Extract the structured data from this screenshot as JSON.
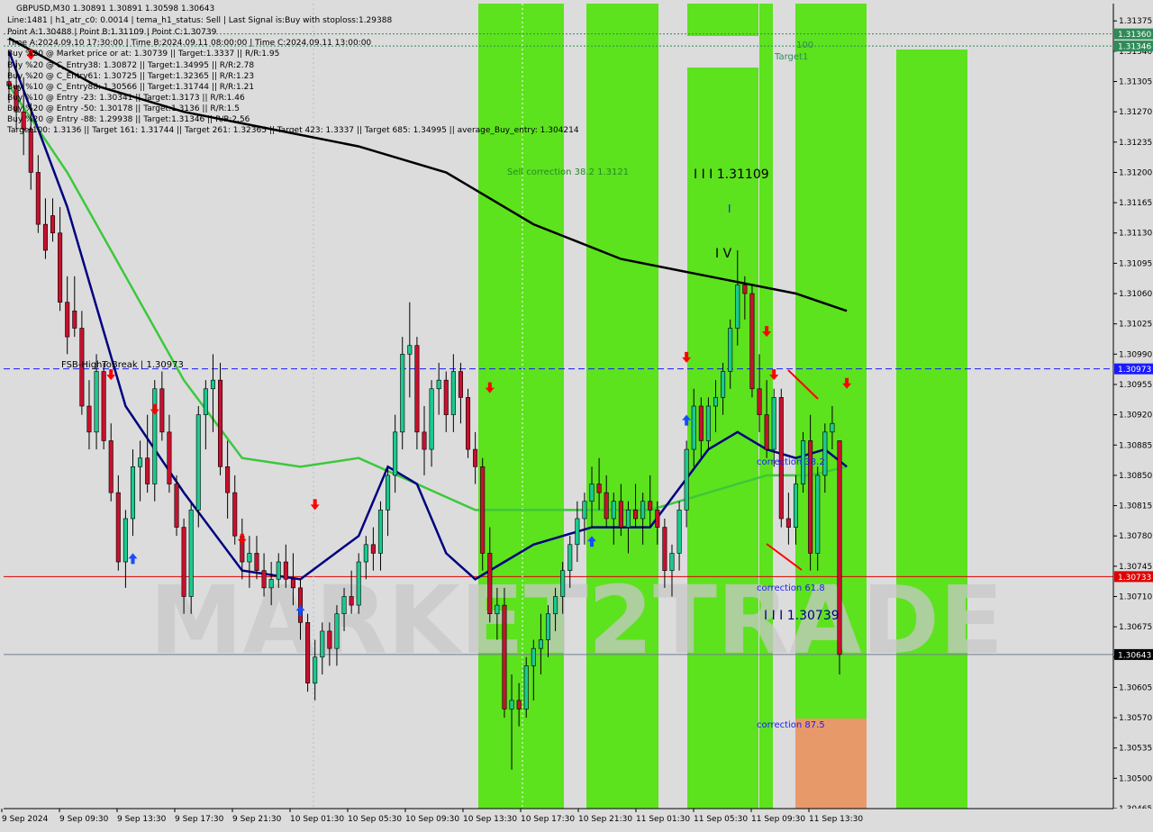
{
  "header": {
    "lines": [
      "GBPUSD,M30  1.30891 1.30891 1.30598 1.30643",
      "Line:1481  |  h1_atr_c0: 0.0014  |  tema_h1_status: Sell  |  Last Signal is:Buy with stoploss:1.29388",
      "Point A:1.30488  |  Point B:1.31109  |  Point C:1.30739",
      "Time A:2024.09.10 17:30:00  |  Time B:2024.09.11 08:00:00  |  Time C:2024.09.11 13:00:00",
      "Buy %20 @ Market price or at: 1.30739  ||  Target:1.3337  ||  R/R:1.95",
      "Buy %20 @ C_Entry38: 1.30872  ||  Target:1.34995  ||  R/R:2.78",
      "Buy %20 @ C_Entry61: 1.30725  ||  Target:1.32365  ||  R/R:1.23",
      "Buy %10 @ C_Entry88: 1.30566  ||  Target:1.31744  ||  R/R:1.21",
      "Buy %10 @ Entry -23: 1.30341  ||  Target:1.3173  ||  R/R:1.46",
      "Buy %20 @ Entry -50: 1.30178  ||  Target:1.3136  ||  R/R:1.5",
      "Buy %20 @ Entry -88: 1.29938  ||  Target:1.31346  ||  R/R:2.56",
      "Target100: 1.3136  ||  Target 161: 1.31744  ||  Target 261: 1.32365  ||  Target 423: 1.3337  ||  Target 685: 1.34995  ||  average_Buy_entry: 1.304214"
    ]
  },
  "annotations": {
    "fsb": "FSB-HighToBreak  |  1.30973",
    "sell_correction": "Sell correction 38.2  1.3121",
    "wave_b": "I I I 1.31109",
    "wave_i": "I",
    "wave_iv": "I V",
    "wave_c": "I I I 1.30739",
    "corr382": "correction 38.2",
    "corr618": "correction 61.8",
    "corr875": "correction 87.5",
    "target1": "Target1",
    "t100": "100"
  },
  "watermark": "MARKET2TRADE",
  "colors": {
    "background": "#dcdcdc",
    "bull_candle": "#1bc98e",
    "bear_candle": "#c8102e",
    "green_zone": "#5de21e",
    "orange_zone": "#e8996a",
    "ema_black": "#000000",
    "ema_navy": "#000080",
    "ema_green": "#3cc83c",
    "envelope": "#ff5a00",
    "fsb_line": "#1a1aff",
    "c_line": "#e00000",
    "last_line": "#708090",
    "target_line": "#2e8b57",
    "arrow_up": "#1a4cff",
    "arrow_down": "#ff0000"
  },
  "chart_data": {
    "type": "candlestick",
    "symbol": "GBPUSD",
    "timeframe": "M30",
    "ylim": [
      1.30465,
      1.31395
    ],
    "y_ticks": [
      "1.31375",
      "1.31340",
      "1.31305",
      "1.31270",
      "1.31235",
      "1.31200",
      "1.31165",
      "1.31130",
      "1.31095",
      "1.31060",
      "1.31025",
      "1.30990",
      "1.30955",
      "1.30920",
      "1.30885",
      "1.30850",
      "1.30815",
      "1.30780",
      "1.30745",
      "1.30710",
      "1.30675",
      "1.30640",
      "1.30605",
      "1.30570",
      "1.30535",
      "1.30500",
      "1.30465"
    ],
    "x_ticks": [
      "9 Sep 2024",
      "9 Sep 09:30",
      "9 Sep 13:30",
      "9 Sep 17:30",
      "9 Sep 21:30",
      "10 Sep 01:30",
      "10 Sep 05:30",
      "10 Sep 09:30",
      "10 Sep 13:30",
      "10 Sep 17:30",
      "10 Sep 21:30",
      "11 Sep 01:30",
      "11 Sep 05:30",
      "11 Sep 09:30",
      "11 Sep 13:30"
    ],
    "price_labels": {
      "target_a": "1.31360",
      "target_b": "1.31346",
      "fsb": "1.30973",
      "c_point": "1.30733",
      "last": "1.30643"
    },
    "levels": {
      "target_a": 1.3136,
      "target_b": 1.31346,
      "fsb": 1.30973,
      "c_point": 1.30733,
      "last": 1.30643
    },
    "ohlc": [
      [
        1.31305,
        1.3134,
        1.3128,
        1.313
      ],
      [
        1.313,
        1.3133,
        1.3125,
        1.3127
      ],
      [
        1.3127,
        1.3131,
        1.3122,
        1.3125
      ],
      [
        1.3125,
        1.3128,
        1.3118,
        1.312
      ],
      [
        1.312,
        1.3122,
        1.3113,
        1.3114
      ],
      [
        1.3114,
        1.3117,
        1.311,
        1.3111
      ],
      [
        1.3115,
        1.3117,
        1.3112,
        1.3113
      ],
      [
        1.3113,
        1.3116,
        1.3104,
        1.3105
      ],
      [
        1.3105,
        1.3108,
        1.3099,
        1.3101
      ],
      [
        1.3104,
        1.3108,
        1.3101,
        1.3102
      ],
      [
        1.3102,
        1.3104,
        1.3092,
        1.3093
      ],
      [
        1.3093,
        1.3096,
        1.3088,
        1.309
      ],
      [
        1.309,
        1.3099,
        1.3088,
        1.3097
      ],
      [
        1.3097,
        1.3098,
        1.3088,
        1.3089
      ],
      [
        1.3089,
        1.3091,
        1.3082,
        1.3083
      ],
      [
        1.3083,
        1.3085,
        1.3074,
        1.3075
      ],
      [
        1.3075,
        1.3081,
        1.3072,
        1.308
      ],
      [
        1.308,
        1.3088,
        1.3078,
        1.3086
      ],
      [
        1.3086,
        1.3089,
        1.3082,
        1.3087
      ],
      [
        1.3087,
        1.3092,
        1.3083,
        1.3084
      ],
      [
        1.3084,
        1.3096,
        1.3082,
        1.3095
      ],
      [
        1.3095,
        1.3097,
        1.3089,
        1.309
      ],
      [
        1.309,
        1.3092,
        1.3083,
        1.3084
      ],
      [
        1.3084,
        1.3085,
        1.3078,
        1.3079
      ],
      [
        1.3079,
        1.308,
        1.3069,
        1.3071
      ],
      [
        1.3071,
        1.3082,
        1.3069,
        1.3081
      ],
      [
        1.3081,
        1.3093,
        1.3079,
        1.3092
      ],
      [
        1.3092,
        1.3096,
        1.3088,
        1.3095
      ],
      [
        1.3095,
        1.3099,
        1.309,
        1.3096
      ],
      [
        1.3096,
        1.3098,
        1.3085,
        1.3086
      ],
      [
        1.3086,
        1.3089,
        1.308,
        1.3083
      ],
      [
        1.3083,
        1.3085,
        1.3077,
        1.3078
      ],
      [
        1.3078,
        1.308,
        1.3073,
        1.3075
      ],
      [
        1.3075,
        1.3078,
        1.3072,
        1.3076
      ],
      [
        1.3076,
        1.3078,
        1.3073,
        1.3074
      ],
      [
        1.3074,
        1.3076,
        1.3071,
        1.3072
      ],
      [
        1.3072,
        1.3075,
        1.307,
        1.3073
      ],
      [
        1.3073,
        1.3076,
        1.3072,
        1.3075
      ],
      [
        1.3075,
        1.3077,
        1.3072,
        1.3073
      ],
      [
        1.3073,
        1.3076,
        1.307,
        1.3072
      ],
      [
        1.3072,
        1.3073,
        1.3066,
        1.3068
      ],
      [
        1.3068,
        1.3069,
        1.306,
        1.3061
      ],
      [
        1.3061,
        1.3066,
        1.3059,
        1.3064
      ],
      [
        1.3064,
        1.3068,
        1.3062,
        1.3067
      ],
      [
        1.3067,
        1.3068,
        1.3063,
        1.3065
      ],
      [
        1.3065,
        1.307,
        1.3063,
        1.3069
      ],
      [
        1.3069,
        1.3072,
        1.3067,
        1.3071
      ],
      [
        1.3071,
        1.3074,
        1.3069,
        1.307
      ],
      [
        1.307,
        1.3076,
        1.3069,
        1.3075
      ],
      [
        1.3075,
        1.3078,
        1.3073,
        1.3077
      ],
      [
        1.3077,
        1.3079,
        1.3074,
        1.3076
      ],
      [
        1.3076,
        1.3082,
        1.3074,
        1.3081
      ],
      [
        1.3081,
        1.3086,
        1.3078,
        1.3085
      ],
      [
        1.3085,
        1.3092,
        1.3083,
        1.309
      ],
      [
        1.309,
        1.3101,
        1.3088,
        1.3099
      ],
      [
        1.3099,
        1.3105,
        1.3094,
        1.31
      ],
      [
        1.31,
        1.3101,
        1.3088,
        1.309
      ],
      [
        1.309,
        1.3093,
        1.3085,
        1.3088
      ],
      [
        1.3088,
        1.3096,
        1.3086,
        1.3095
      ],
      [
        1.3095,
        1.3098,
        1.3092,
        1.3096
      ],
      [
        1.3096,
        1.3097,
        1.309,
        1.3092
      ],
      [
        1.3092,
        1.3099,
        1.309,
        1.3097
      ],
      [
        1.3097,
        1.3098,
        1.3091,
        1.3094
      ],
      [
        1.3094,
        1.3095,
        1.3087,
        1.3088
      ],
      [
        1.3088,
        1.309,
        1.3084,
        1.3086
      ],
      [
        1.3086,
        1.3087,
        1.3074,
        1.3076
      ],
      [
        1.3076,
        1.3079,
        1.3068,
        1.3069
      ],
      [
        1.3069,
        1.3072,
        1.3066,
        1.307
      ],
      [
        1.307,
        1.3072,
        1.3057,
        1.3058
      ],
      [
        1.3058,
        1.3062,
        1.3051,
        1.3059
      ],
      [
        1.3059,
        1.3061,
        1.3056,
        1.3058
      ],
      [
        1.3058,
        1.3064,
        1.3057,
        1.3063
      ],
      [
        1.3063,
        1.3066,
        1.3059,
        1.3065
      ],
      [
        1.3065,
        1.3069,
        1.3062,
        1.3066
      ],
      [
        1.3066,
        1.307,
        1.3064,
        1.3069
      ],
      [
        1.3069,
        1.3072,
        1.3067,
        1.3071
      ],
      [
        1.3071,
        1.3075,
        1.3069,
        1.3074
      ],
      [
        1.3074,
        1.3078,
        1.3072,
        1.3077
      ],
      [
        1.3077,
        1.3082,
        1.3075,
        1.308
      ],
      [
        1.308,
        1.3083,
        1.3077,
        1.3082
      ],
      [
        1.3082,
        1.3086,
        1.3079,
        1.3084
      ],
      [
        1.3084,
        1.3087,
        1.3081,
        1.3083
      ],
      [
        1.3083,
        1.3085,
        1.3079,
        1.308
      ],
      [
        1.308,
        1.3083,
        1.3077,
        1.3082
      ],
      [
        1.3082,
        1.3084,
        1.3078,
        1.3079
      ],
      [
        1.3079,
        1.3082,
        1.3076,
        1.3081
      ],
      [
        1.3081,
        1.3084,
        1.3079,
        1.308
      ],
      [
        1.308,
        1.3083,
        1.3077,
        1.3082
      ],
      [
        1.3082,
        1.3085,
        1.3079,
        1.3081
      ],
      [
        1.3081,
        1.3082,
        1.3077,
        1.3079
      ],
      [
        1.3079,
        1.308,
        1.3072,
        1.3074
      ],
      [
        1.3074,
        1.3077,
        1.3071,
        1.3076
      ],
      [
        1.3076,
        1.3082,
        1.3074,
        1.3081
      ],
      [
        1.3081,
        1.3089,
        1.3079,
        1.3088
      ],
      [
        1.3088,
        1.3095,
        1.3086,
        1.3093
      ],
      [
        1.3093,
        1.3094,
        1.3087,
        1.3089
      ],
      [
        1.3089,
        1.3094,
        1.3088,
        1.3093
      ],
      [
        1.3093,
        1.3096,
        1.309,
        1.3094
      ],
      [
        1.3094,
        1.3098,
        1.3092,
        1.3097
      ],
      [
        1.3097,
        1.3103,
        1.3095,
        1.3102
      ],
      [
        1.3102,
        1.3111,
        1.31,
        1.3107
      ],
      [
        1.3107,
        1.3108,
        1.3103,
        1.3106
      ],
      [
        1.3106,
        1.3107,
        1.3094,
        1.3095
      ],
      [
        1.3095,
        1.3099,
        1.309,
        1.3092
      ],
      [
        1.3092,
        1.3096,
        1.3087,
        1.3088
      ],
      [
        1.3088,
        1.3095,
        1.3086,
        1.3094
      ],
      [
        1.3094,
        1.3095,
        1.3079,
        1.308
      ],
      [
        1.308,
        1.3083,
        1.3077,
        1.3079
      ],
      [
        1.3079,
        1.3085,
        1.3077,
        1.3084
      ],
      [
        1.3084,
        1.309,
        1.3083,
        1.3089
      ],
      [
        1.3089,
        1.3092,
        1.3074,
        1.3076
      ],
      [
        1.3076,
        1.3086,
        1.3074,
        1.3085
      ],
      [
        1.3085,
        1.3091,
        1.3083,
        1.309
      ],
      [
        1.309,
        1.3093,
        1.3088,
        1.3091
      ],
      [
        1.3089,
        1.3089,
        1.3062,
        1.30643
      ]
    ],
    "series": [
      {
        "name": "EMA long",
        "color": "#000000",
        "x": [
          0,
          12,
          24,
          36,
          48,
          60,
          72,
          84,
          96,
          108,
          115
        ],
        "y": [
          1.31355,
          1.313,
          1.3127,
          1.3125,
          1.3123,
          1.312,
          1.3114,
          1.311,
          1.3108,
          1.3106,
          1.3104
        ]
      },
      {
        "name": "EMA medium",
        "color": "#3cc83c",
        "x": [
          0,
          8,
          16,
          24,
          32,
          40,
          48,
          56,
          64,
          72,
          80,
          88,
          96,
          104,
          110,
          115
        ],
        "y": [
          1.313,
          1.312,
          1.3108,
          1.3096,
          1.3087,
          1.3086,
          1.3087,
          1.3084,
          1.3081,
          1.3081,
          1.3081,
          1.3081,
          1.3083,
          1.3085,
          1.3085,
          1.3086
        ]
      },
      {
        "name": "EMA short",
        "color": "#000080",
        "x": [
          0,
          8,
          16,
          24,
          32,
          40,
          48,
          52,
          56,
          60,
          64,
          68,
          72,
          76,
          80,
          88,
          96,
          100,
          104,
          108,
          112,
          115
        ],
        "y": [
          1.3134,
          1.3116,
          1.3093,
          1.3083,
          1.3074,
          1.3073,
          1.3078,
          1.3086,
          1.3084,
          1.3076,
          1.3073,
          1.3075,
          1.3077,
          1.3078,
          1.3079,
          1.3079,
          1.3088,
          1.309,
          1.3088,
          1.3087,
          1.3088,
          1.3086
        ]
      }
    ]
  }
}
